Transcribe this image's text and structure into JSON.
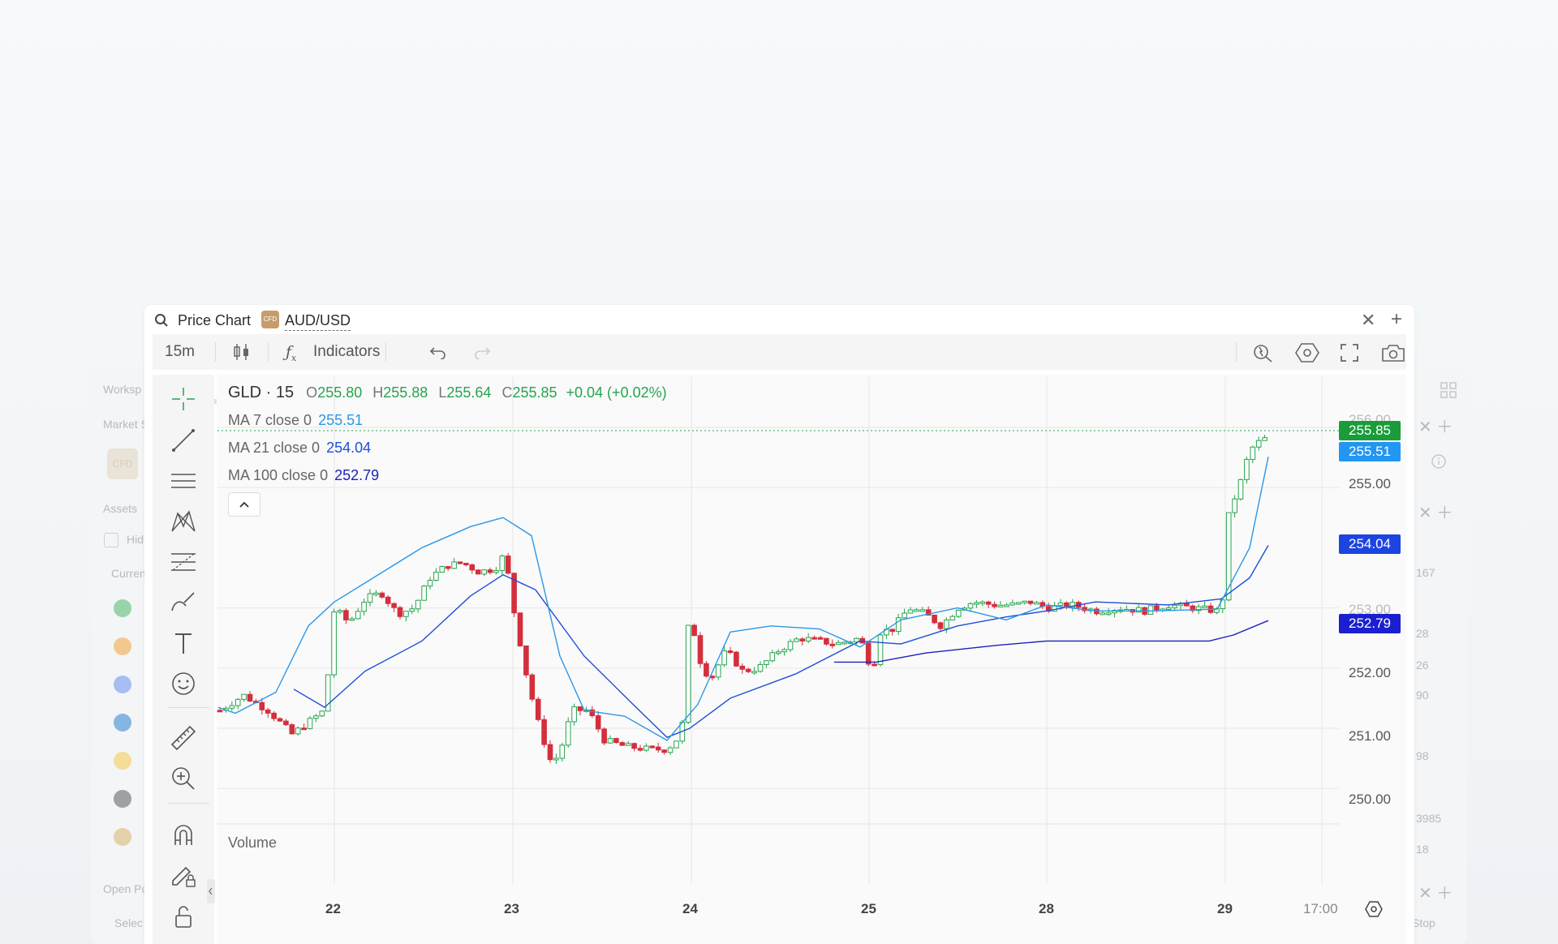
{
  "background": {
    "labels": [
      "Worksp",
      "Market S",
      "Assets",
      "Hid",
      "Curren",
      "Open Po",
      "Selec",
      "Stop"
    ],
    "cfd_badge": "CFD",
    "numbers": [
      "167",
      "28",
      "26",
      "90",
      "98",
      "3985",
      "18"
    ],
    "coin_colors": [
      "#4cb86b",
      "#f2a33a",
      "#6a8cf2",
      "#2e7fd1",
      "#f2c84b",
      "#555a60",
      "#d8b26a"
    ]
  },
  "window": {
    "title": "Price Chart",
    "badge": "CFD",
    "symbol": "AUD/USD",
    "close_icon": "close-icon",
    "add_icon": "plus-icon"
  },
  "toolbar": {
    "interval": "15m",
    "indicators_label": "Indicators",
    "icons": [
      "candlestick-icon",
      "function-icon",
      "undo-icon",
      "redo-icon",
      "alert-icon",
      "settings-icon",
      "fullscreen-icon",
      "camera-icon"
    ]
  },
  "drawing_tools": [
    "crosshair-icon",
    "trend-line-icon",
    "horizontal-lines-icon",
    "pattern-icon",
    "fib-icon",
    "brush-icon",
    "text-icon",
    "emoji-icon",
    "ruler-icon",
    "zoom-in-icon",
    "magnet-icon",
    "pencil-lock-icon",
    "unlock-icon"
  ],
  "legend": {
    "symbol": "GLD · 15",
    "o_label": "O",
    "o": "255.80",
    "h_label": "H",
    "h": "255.88",
    "l_label": "L",
    "l": "255.64",
    "c_label": "C",
    "c": "255.85",
    "change": "+0.04 (+0.02%)"
  },
  "moving_averages": [
    {
      "label": "MA 7 close 0",
      "value": "255.51",
      "color": "#2b97e8"
    },
    {
      "label": "MA 21 close 0",
      "value": "254.04",
      "color": "#1d4fd8"
    },
    {
      "label": "MA 100 close 0",
      "value": "252.79",
      "color": "#1e22b8"
    }
  ],
  "price_tags": [
    {
      "value": "255.85",
      "color": "#1a9c3b"
    },
    {
      "value": "255.51",
      "color": "#2196f3"
    },
    {
      "value": "254.04",
      "color": "#1c44e0"
    },
    {
      "value": "252.79",
      "color": "#1a1fcf"
    }
  ],
  "y_axis": [
    "256.00",
    "255.00",
    "253.00",
    "252.00",
    "251.00",
    "250.00"
  ],
  "x_axis": [
    "22",
    "23",
    "24",
    "25",
    "28",
    "29",
    "17:00"
  ],
  "volume_label": "Volume",
  "colors": {
    "up": "#26a44d",
    "down": "#d32f3c",
    "grid": "#e7e7e7"
  },
  "chart_data": {
    "type": "line",
    "title": "GLD · 15",
    "x": [
      "22",
      "23",
      "24",
      "25",
      "28",
      "29",
      "17:00"
    ],
    "ylim": [
      249.6,
      256.2
    ],
    "series": [
      {
        "name": "MA 7 close 0",
        "values": [
          251.4,
          254.4,
          250.5,
          252.5,
          253.0,
          255.51
        ]
      },
      {
        "name": "MA 21 close 0",
        "values": [
          251.4,
          253.7,
          250.8,
          252.4,
          252.8,
          254.04
        ]
      },
      {
        "name": "MA 100 close 0",
        "values": [
          252.1,
          252.3,
          252.45,
          252.4,
          252.79
        ]
      }
    ]
  }
}
